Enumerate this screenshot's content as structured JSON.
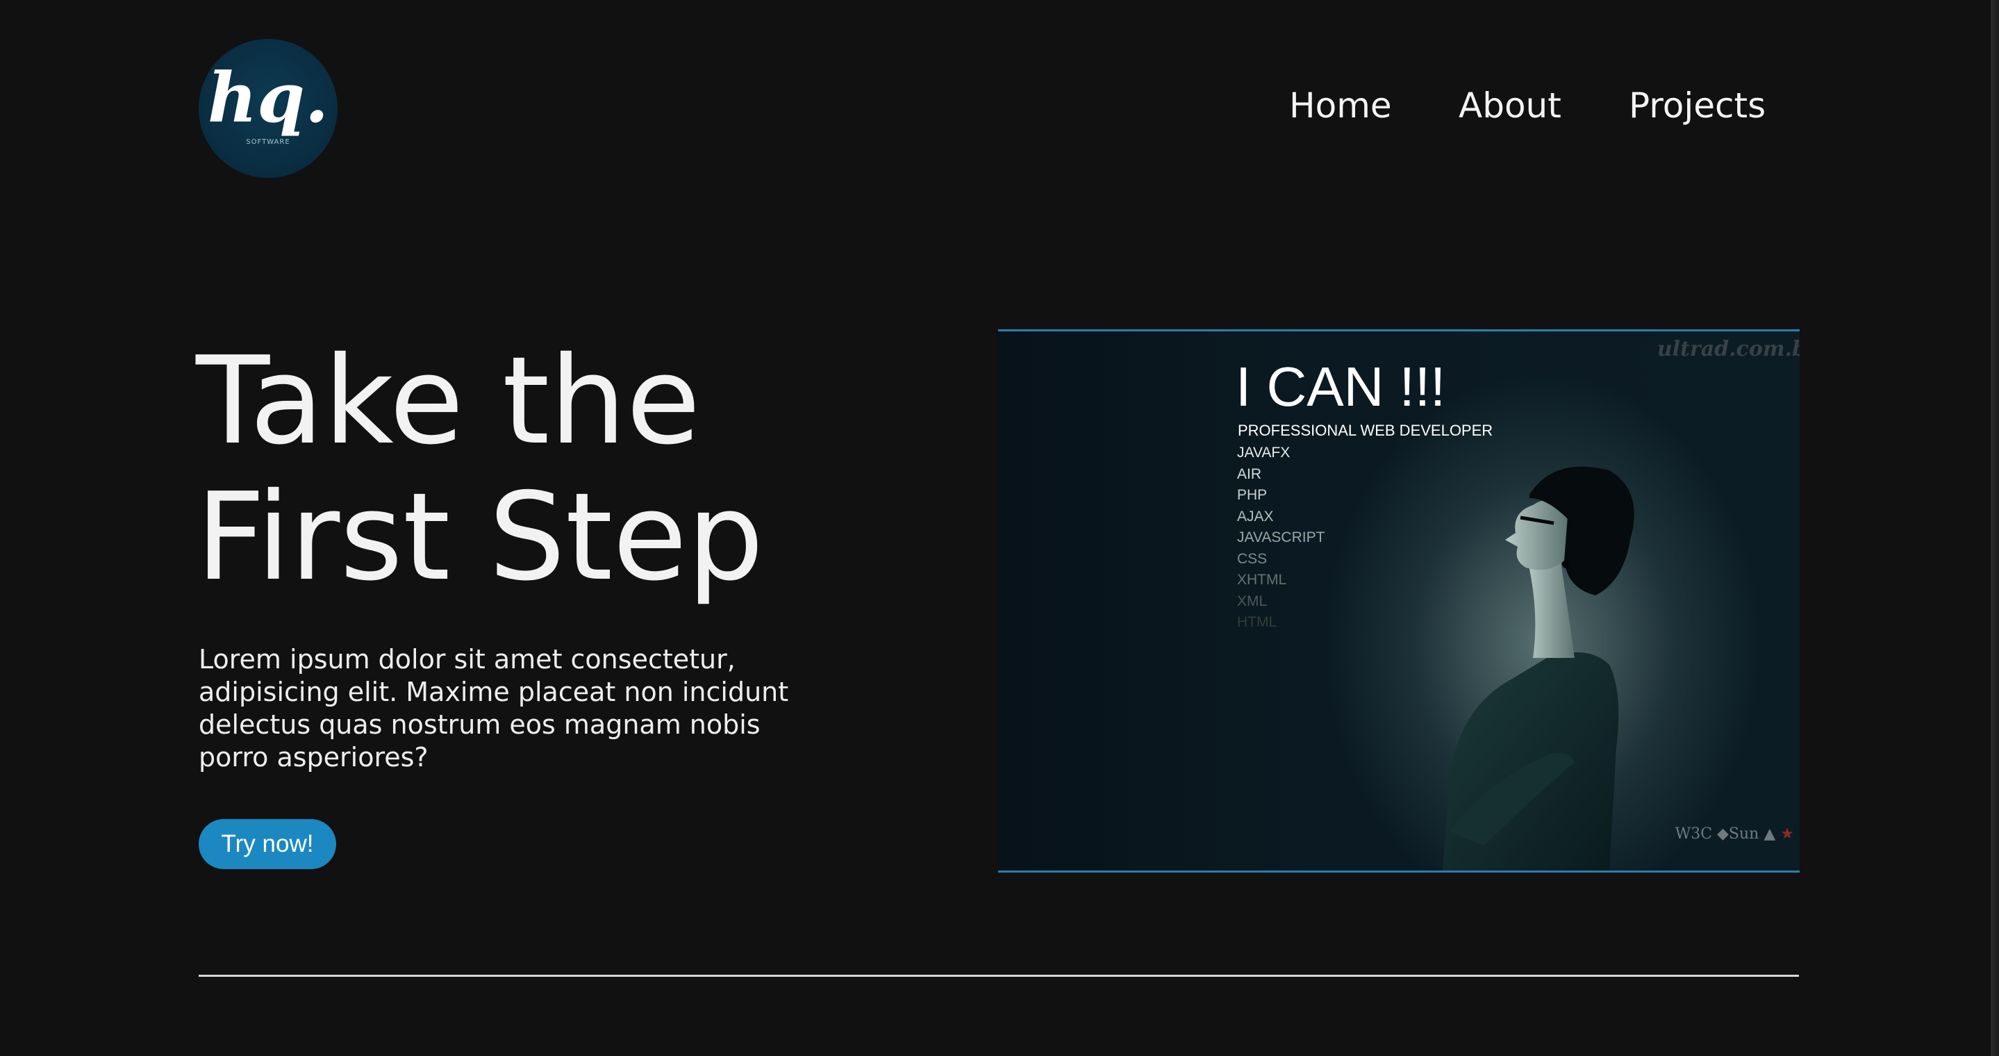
{
  "brand": {
    "logo_mark": "hq.",
    "logo_sub": "SOFTWARE"
  },
  "nav": {
    "items": [
      "Home",
      "About",
      "Projects"
    ]
  },
  "hero": {
    "title_line1": "Take the",
    "title_line2": "First Step",
    "copy": "Lorem ipsum dolor sit amet consectetur, adipisicing elit. Maxime placeat non incidunt delectus quas nostrum eos magnam nobis porro asperiores?",
    "cta_label": "Try now!"
  },
  "image": {
    "title": "I CAN !!!",
    "subtitle": "PROFESSIONAL WEB DEVELOPER",
    "skills": [
      "JAVAFX",
      "AIR",
      "PHP",
      "AJAX",
      "JAVASCRIPT",
      "CSS",
      "XHTML",
      "XML",
      "HTML"
    ],
    "watermark": "ultrad.com.b",
    "badges": "W3C ◆Sun",
    "colors": {
      "accent": "#1b88c2",
      "background": "#111111"
    }
  }
}
